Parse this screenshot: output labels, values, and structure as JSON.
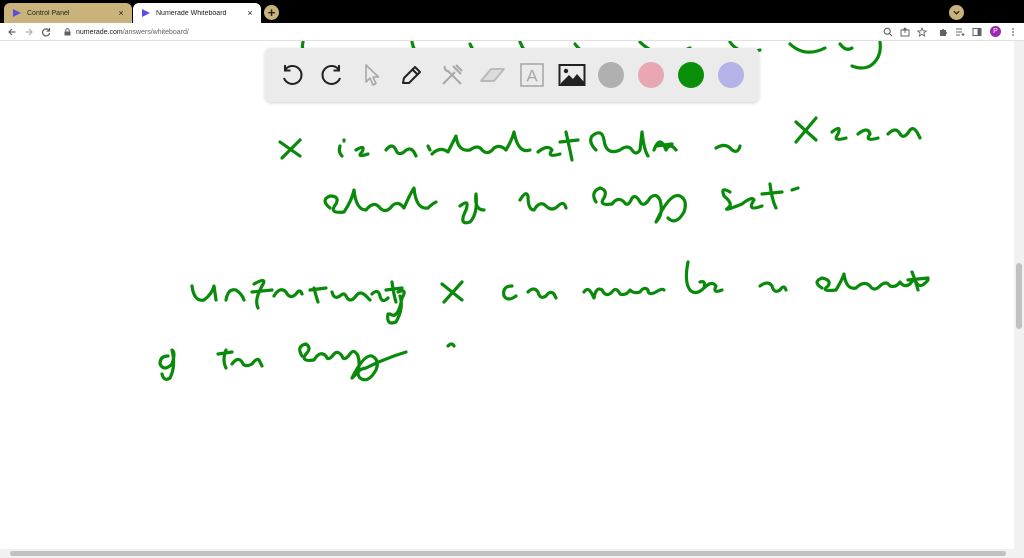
{
  "tabs": [
    {
      "title": "Control Panel",
      "close": "×",
      "active": false
    },
    {
      "title": "Numerade Whiteboard",
      "close": "×",
      "active": true
    }
  ],
  "new_tab_label": "+",
  "address": {
    "domain": "numerade.com",
    "path": "/answers/whiteboard/"
  },
  "profile_initial": "P",
  "toolbar": {
    "tools": [
      {
        "name": "undo",
        "icon": "undo-icon"
      },
      {
        "name": "redo",
        "icon": "redo-icon"
      },
      {
        "name": "select",
        "icon": "cursor-icon"
      },
      {
        "name": "pen",
        "icon": "pen-icon"
      },
      {
        "name": "tools",
        "icon": "hammer-icon"
      },
      {
        "name": "eraser",
        "icon": "eraser-icon"
      },
      {
        "name": "text",
        "icon": "text-icon",
        "label": "A"
      },
      {
        "name": "image",
        "icon": "image-icon"
      }
    ],
    "colors": [
      "#b0b0b0",
      "#e8a7b3",
      "#0a8f0a",
      "#b3b3e8"
    ],
    "selected_color": "#0a8f0a"
  },
  "ink_color": "#0a8a0a"
}
